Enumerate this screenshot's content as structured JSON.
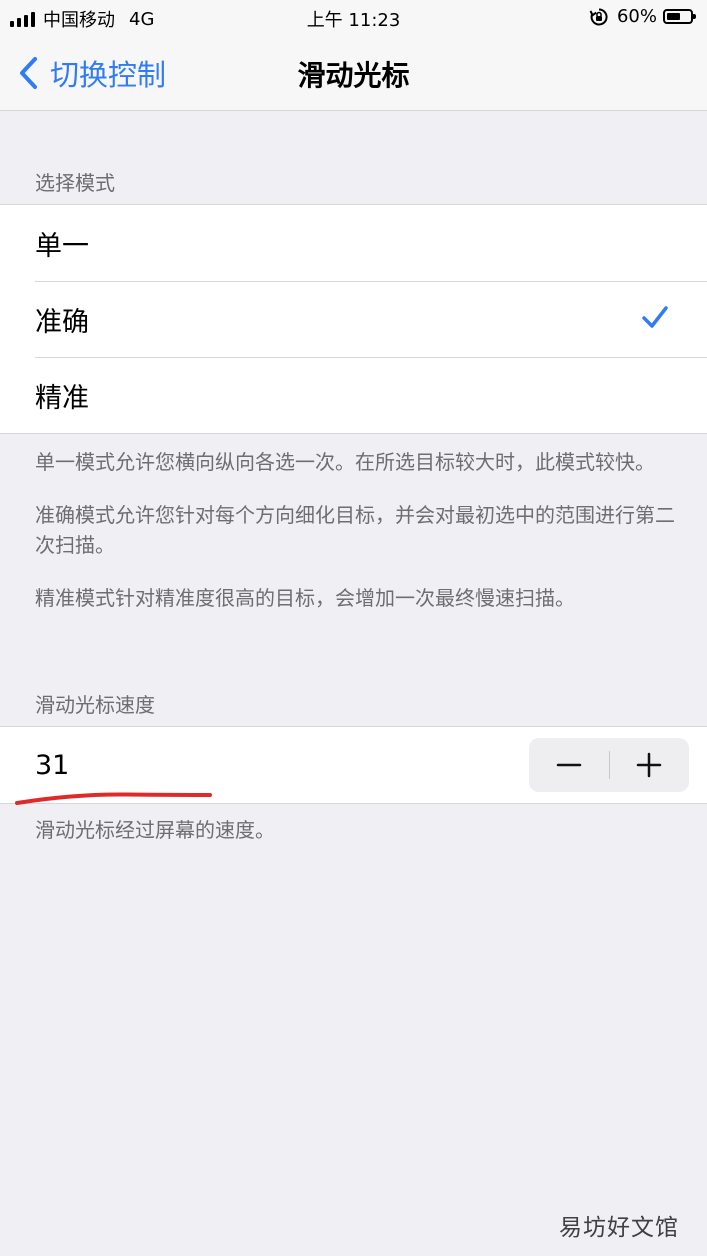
{
  "status_bar": {
    "carrier": "中国移动",
    "network": "4G",
    "time": "上午 11:23",
    "battery": "60%",
    "battery_level": 0.6
  },
  "nav": {
    "back_label": "切换控制",
    "title": "滑动光标"
  },
  "mode_section": {
    "header": "选择模式",
    "options": [
      {
        "label": "单一",
        "selected": false
      },
      {
        "label": "准确",
        "selected": true
      },
      {
        "label": "精准",
        "selected": false
      }
    ],
    "footer": [
      "单一模式允许您横向纵向各选一次。在所选目标较大时，此模式较快。",
      "准确模式允许您针对每个方向细化目标，并会对最初选中的范围进行第二次扫描。",
      "精准模式针对精准度很高的目标，会增加一次最终慢速扫描。"
    ]
  },
  "speed_section": {
    "header": "滑动光标速度",
    "value": "31",
    "footer": "滑动光标经过屏幕的速度。"
  },
  "colors": {
    "accent": "#2f7cf6",
    "annotation": "#e02a2a"
  },
  "watermark": "易坊好文馆"
}
